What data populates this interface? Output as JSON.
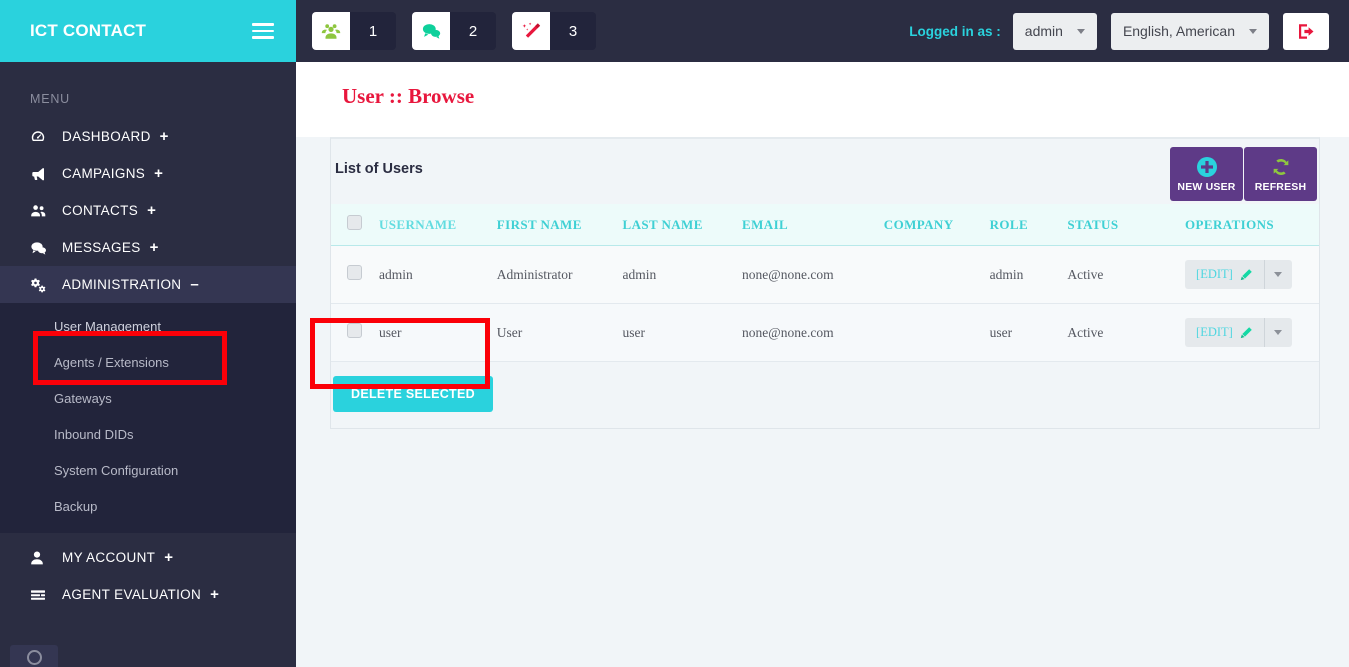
{
  "brand": {
    "title": "ICT CONTACT",
    "menu_icon": "hamburger-icon"
  },
  "sidebar": {
    "menu_label": "MENU",
    "items": [
      {
        "label": "DASHBOARD",
        "icon": "dashboard-icon",
        "toggle": "+"
      },
      {
        "label": "CAMPAIGNS",
        "icon": "megaphone-icon",
        "toggle": "+"
      },
      {
        "label": "CONTACTS",
        "icon": "users-icon",
        "toggle": "+"
      },
      {
        "label": "MESSAGES",
        "icon": "comments-icon",
        "toggle": "+"
      },
      {
        "label": "ADMINISTRATION",
        "icon": "cogs-icon",
        "toggle": "–"
      }
    ],
    "submenu": [
      {
        "label": "User Management",
        "active": true
      },
      {
        "label": "Agents / Extensions",
        "active": false
      },
      {
        "label": "Gateways",
        "active": false
      },
      {
        "label": "Inbound DIDs",
        "active": false
      },
      {
        "label": "System Configuration",
        "active": false
      },
      {
        "label": "Backup",
        "active": false
      }
    ],
    "bottom_items": [
      {
        "label": "MY ACCOUNT",
        "icon": "user-icon",
        "toggle": "+"
      },
      {
        "label": "AGENT EVALUATION",
        "icon": "list-icon",
        "toggle": "+"
      }
    ]
  },
  "topbar": {
    "badges": [
      {
        "icon": "users-group-icon",
        "count": "1",
        "color": "#8ec63f"
      },
      {
        "icon": "comments-icon",
        "count": "2",
        "color": "#0ed09b"
      },
      {
        "icon": "magic-wand-icon",
        "count": "3",
        "color": "#e8173d"
      }
    ],
    "logged_in_label": "Logged in as :",
    "user_select": "admin",
    "language_select": "English, American",
    "logout_icon": "logout-icon"
  },
  "main": {
    "page_title": "User :: Browse",
    "panel_title": "List of Users",
    "new_user_label": "NEW USER",
    "new_user_icon": "plus-circle-icon",
    "refresh_label": "REFRESH",
    "refresh_icon": "refresh-icon",
    "delete_selected_label": "DELETE SELECTED",
    "table": {
      "columns": [
        "USERNAME",
        "FIRST NAME",
        "LAST NAME",
        "EMAIL",
        "COMPANY",
        "ROLE",
        "STATUS",
        "OPERATIONS"
      ],
      "sorted_column": "USERNAME",
      "edit_label": "[EDIT]",
      "edit_icon": "pencil-icon",
      "rows": [
        {
          "username": "admin",
          "first_name": "Administrator",
          "last_name": "admin",
          "email": "none@none.com",
          "company": "",
          "role": "admin",
          "status": "Active"
        },
        {
          "username": "user",
          "first_name": "User",
          "last_name": "user",
          "email": "none@none.com",
          "company": "",
          "role": "user",
          "status": "Active"
        }
      ]
    }
  },
  "annotations": [
    {
      "name": "sidebar-user-management-highlight",
      "color": "#fb0008"
    },
    {
      "name": "delete-selected-highlight",
      "color": "#fb0008"
    }
  ],
  "theme": {
    "brand_cyan": "#2ad2dd",
    "sidebar_dark": "#2b2d42",
    "submenu_dark": "#22243b",
    "accent_purple": "#5e3a87",
    "title_red": "#e8173d",
    "table_header_teal": "#3fd0d4"
  }
}
